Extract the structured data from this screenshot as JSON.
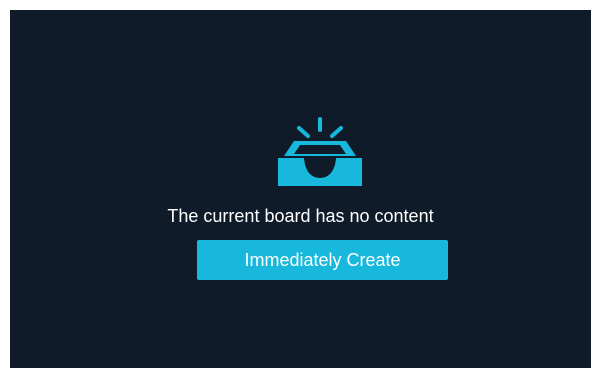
{
  "board": {
    "empty_icon": "empty-inbox-tray-icon",
    "empty_message": "The current board has no content",
    "create_button_label": "Immediately Create"
  },
  "colors": {
    "background": "#0f1b29",
    "accent": "#17b8dc",
    "text": "#ffffff"
  }
}
